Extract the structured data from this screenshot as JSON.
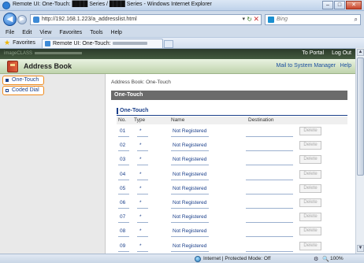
{
  "window": {
    "title": "Remote UI: One-Touch: ████ Series / ████ Series - Windows Internet Explorer",
    "controls": {
      "minimize": "–",
      "maximize": "□",
      "close": "✕"
    }
  },
  "navigation": {
    "back_glyph": "◀",
    "forward_glyph": "▶",
    "url": "http://192.168.1.223/a_addresslist.html",
    "search_placeholder": "Bing",
    "dropdown_glyph": "▾",
    "refresh_glyph": "↻",
    "stop_glyph": "✕",
    "search_glyph": "⌕"
  },
  "menu": [
    "File",
    "Edit",
    "View",
    "Favorites",
    "Tools",
    "Help"
  ],
  "favorites_bar": {
    "favorites_label": "Favorites",
    "tab_label": "Remote UI: One-Touch:"
  },
  "page": {
    "brand": "imageCLASS",
    "to_portal": "To Portal",
    "log_out": "Log Out",
    "title": "Address Book",
    "mail_link": "Mail to System Manager",
    "help_link": "Help",
    "sidebar": [
      {
        "label": "One-Touch",
        "active": true
      },
      {
        "label": "Coded Dial",
        "active": false
      }
    ],
    "breadcrumb": "Address Book: One-Touch",
    "section_title": "One-Touch",
    "subsection_title": "One-Touch",
    "table": {
      "headers": {
        "no": "No.",
        "type": "Type",
        "name": "Name",
        "destination": "Destination"
      },
      "rows": [
        {
          "no": "01",
          "type": "*",
          "name": "Not Registered",
          "action": "Delete"
        },
        {
          "no": "02",
          "type": "*",
          "name": "Not Registered",
          "action": "Delete"
        },
        {
          "no": "03",
          "type": "*",
          "name": "Not Registered",
          "action": "Delete"
        },
        {
          "no": "04",
          "type": "*",
          "name": "Not Registered",
          "action": "Delete"
        },
        {
          "no": "05",
          "type": "*",
          "name": "Not Registered",
          "action": "Delete"
        },
        {
          "no": "06",
          "type": "*",
          "name": "Not Registered",
          "action": "Delete"
        },
        {
          "no": "07",
          "type": "*",
          "name": "Not Registered",
          "action": "Delete"
        },
        {
          "no": "08",
          "type": "*",
          "name": "Not Registered",
          "action": "Delete"
        },
        {
          "no": "09",
          "type": "*",
          "name": "Not Registered",
          "action": "Delete"
        }
      ]
    }
  },
  "status": {
    "zone": "Internet | Protected Mode: Off",
    "zoom": "100%"
  }
}
